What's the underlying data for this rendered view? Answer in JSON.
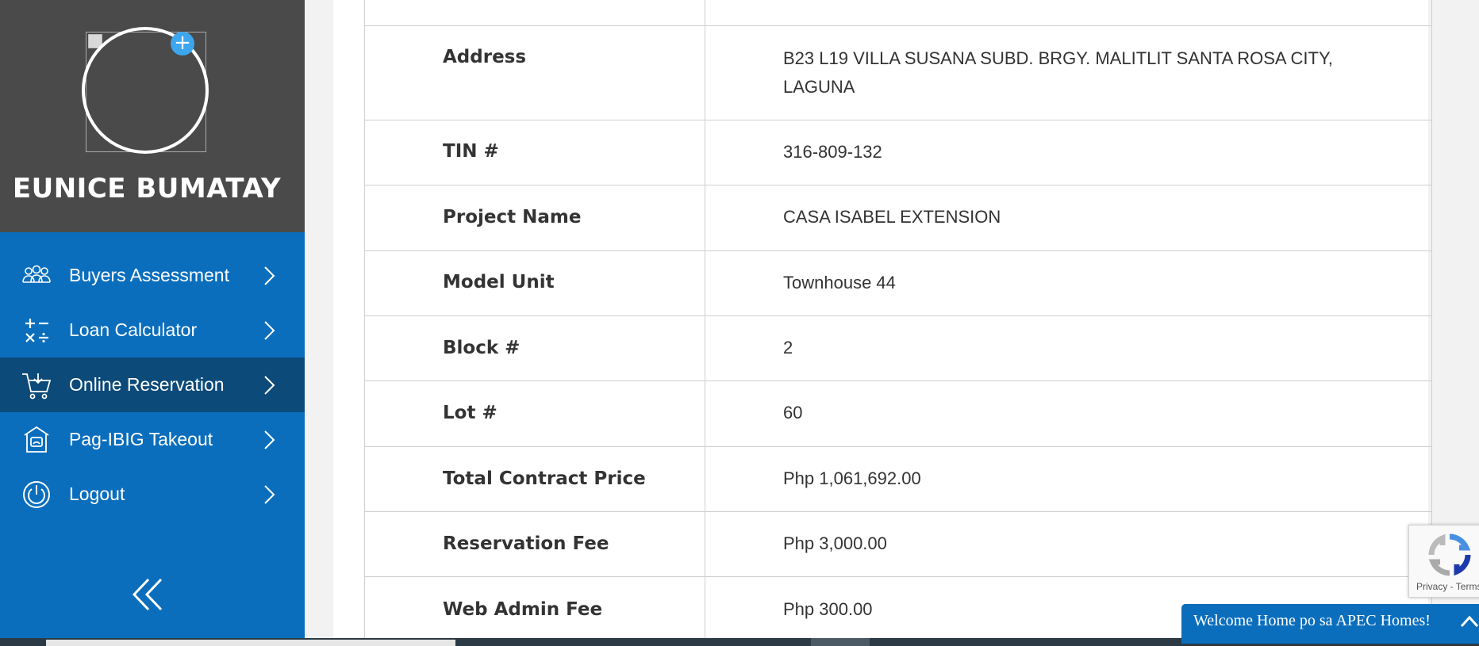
{
  "sidebar": {
    "user_name": "EUNICE BUMATAY",
    "avatar_add_icon": "plus",
    "items": [
      {
        "label": "Buyers Assessment",
        "icon": "users-icon"
      },
      {
        "label": "Loan Calculator",
        "icon": "calculator-icon"
      },
      {
        "label": "Online Reservation",
        "icon": "cart-icon",
        "active": true
      },
      {
        "label": "Pag-IBIG Takeout",
        "icon": "pagibig-house-icon"
      },
      {
        "label": "Logout",
        "icon": "power-icon"
      }
    ],
    "collapse_icon": "double-chevron-left-icon"
  },
  "details": {
    "rows": [
      {
        "label": "Address",
        "value": "B23 L19 VILLA SUSANA SUBD. BRGY. MALITLIT SANTA ROSA CITY, LAGUNA"
      },
      {
        "label": "TIN #",
        "value": "316-809-132"
      },
      {
        "label": "Project Name",
        "value": "CASA ISABEL EXTENSION"
      },
      {
        "label": "Model Unit",
        "value": "Townhouse 44"
      },
      {
        "label": "Block #",
        "value": "2"
      },
      {
        "label": "Lot #",
        "value": "60"
      },
      {
        "label": "Total Contract Price",
        "value": "Php 1,061,692.00"
      },
      {
        "label": "Reservation Fee",
        "value": "Php 3,000.00"
      },
      {
        "label": "Web Admin Fee",
        "value": "Php 300.00"
      }
    ]
  },
  "recaptcha": {
    "links": "Privacy - Terms"
  },
  "chat": {
    "text": "Welcome Home po sa APEC Homes!"
  },
  "colors": {
    "sidebar_blue": "#0a6ebd",
    "sidebar_active": "#0c4a7a",
    "profile_bg": "#4a4a4a"
  }
}
